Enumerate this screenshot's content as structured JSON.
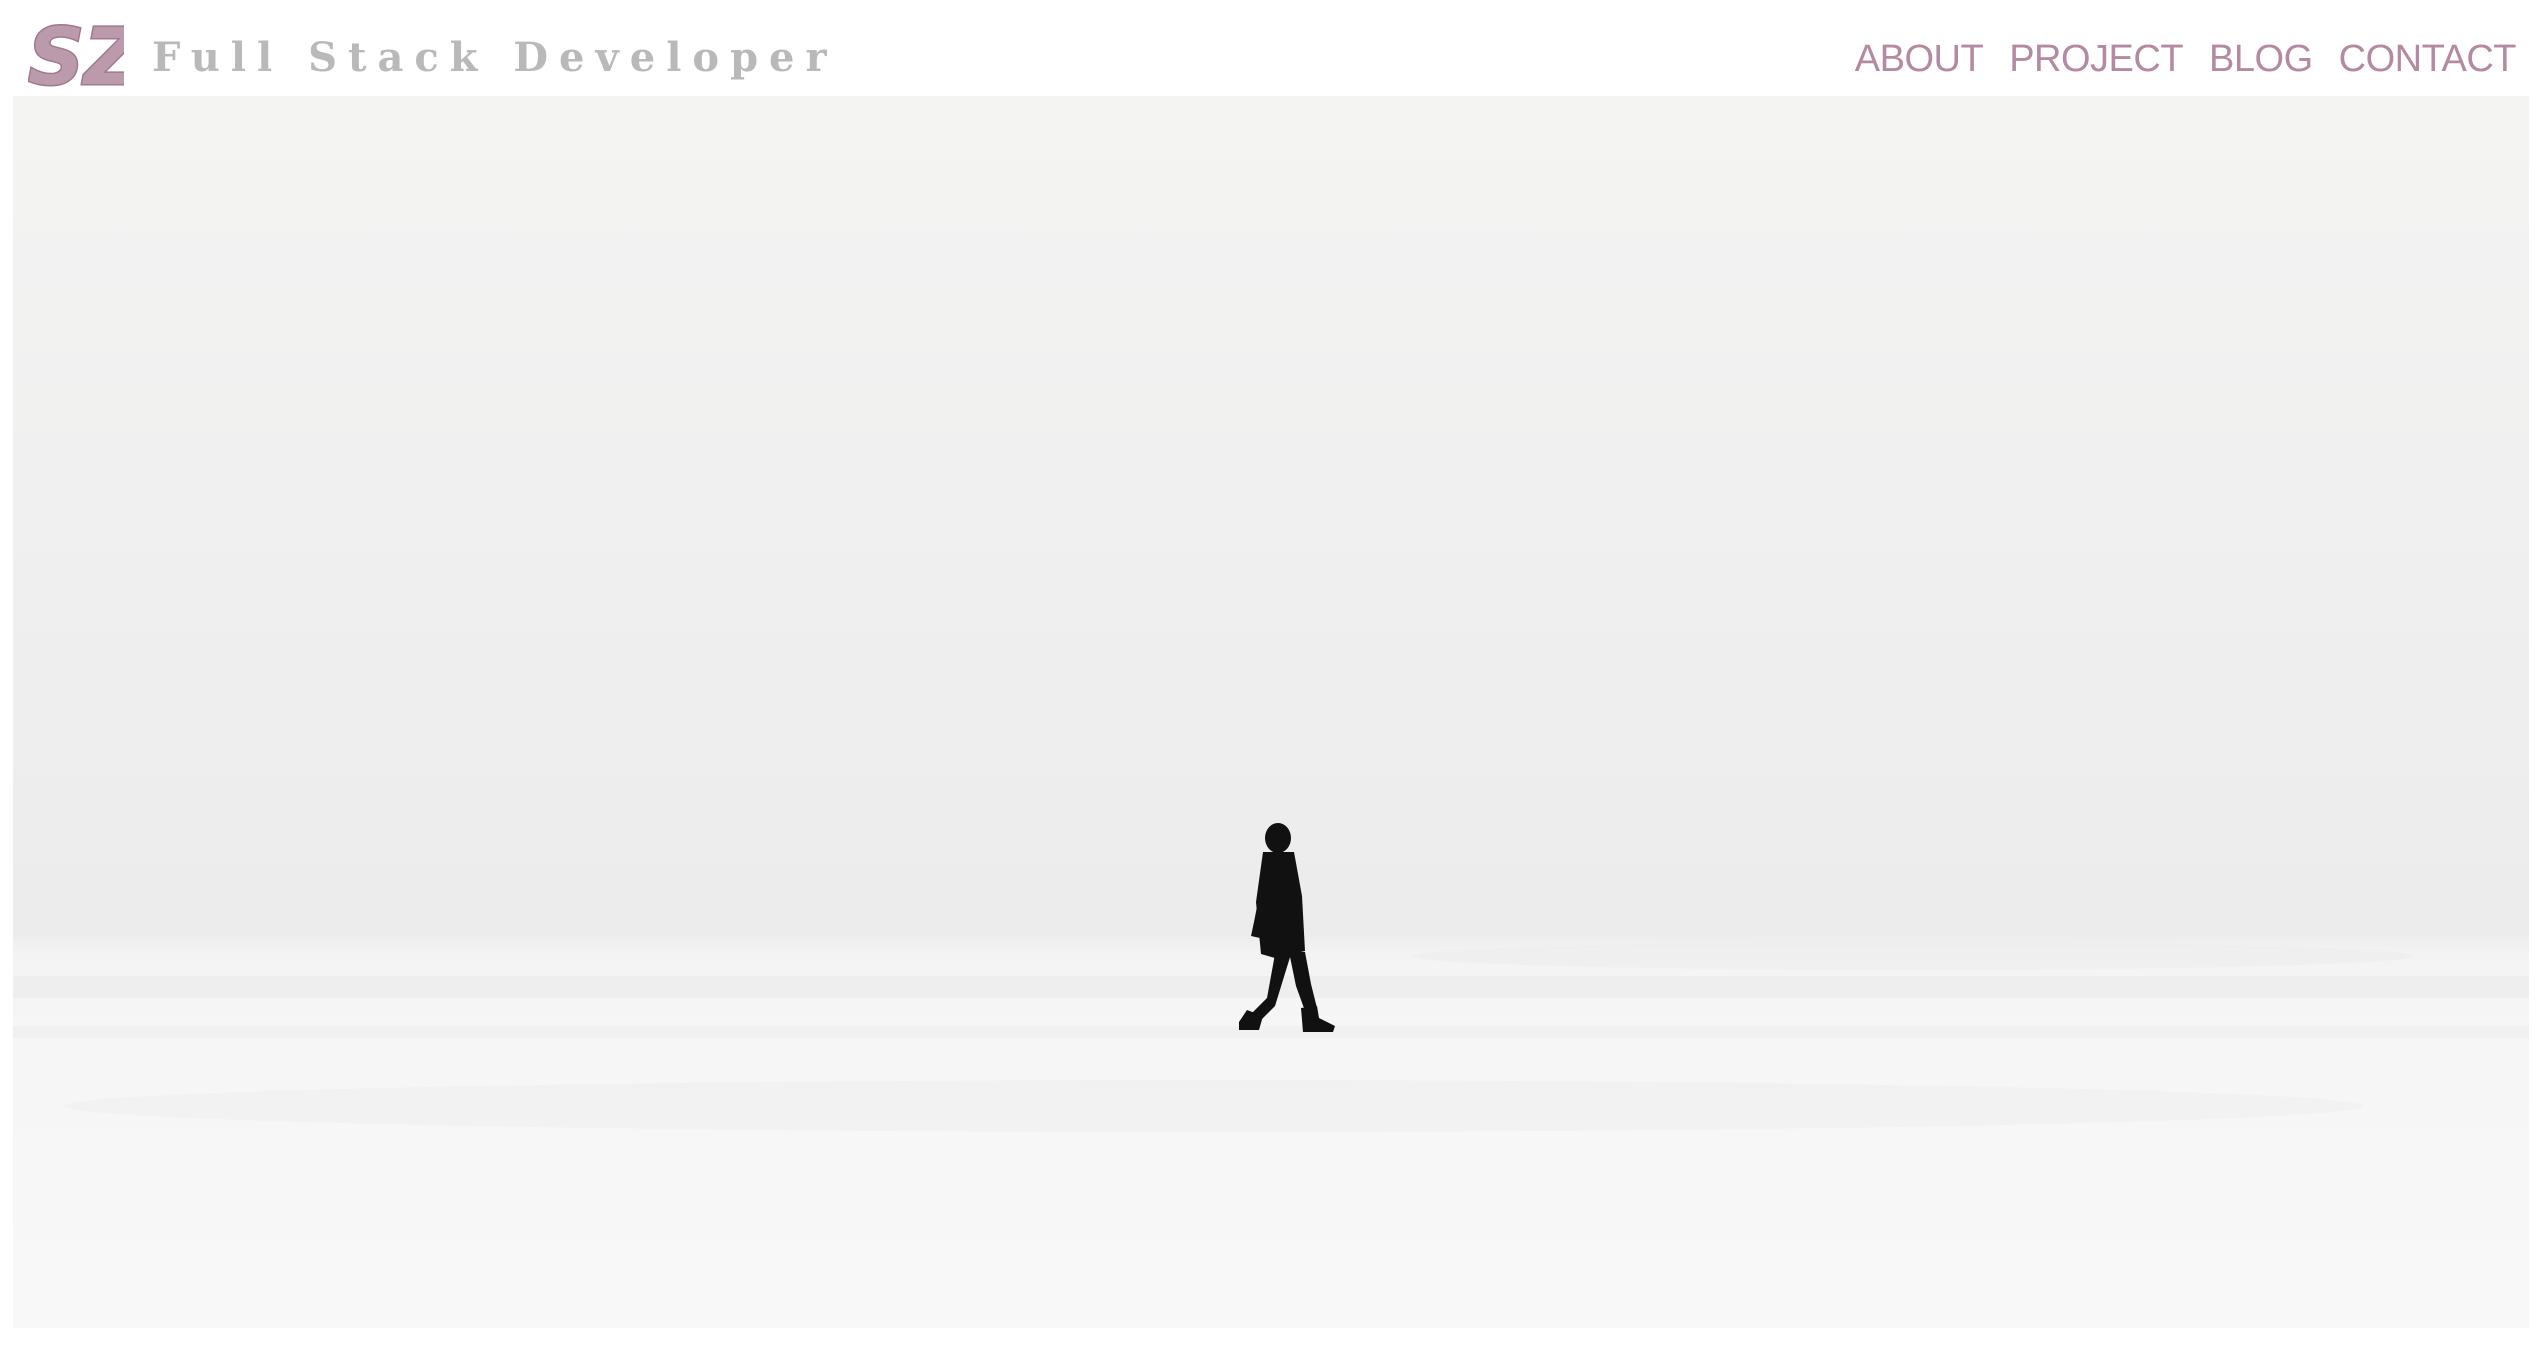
{
  "header": {
    "logo_text": "SZ",
    "tagline": "Full Stack Developer",
    "brand_color": "#b38aa1"
  },
  "nav": {
    "items": [
      {
        "label": "ABOUT"
      },
      {
        "label": "PROJECT"
      },
      {
        "label": "BLOG"
      },
      {
        "label": "CONTACT"
      }
    ]
  },
  "hero": {
    "image_icon": "walking-person-snow-image"
  }
}
